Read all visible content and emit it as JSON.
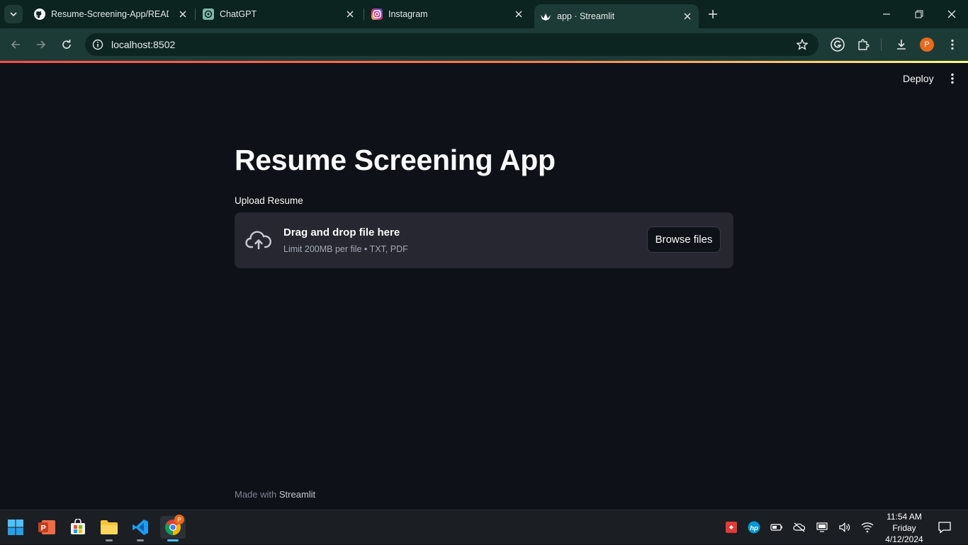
{
  "browser": {
    "tabs": [
      {
        "title": "Resume-Screening-App/READM",
        "icon": "github-icon",
        "active": false
      },
      {
        "title": "ChatGPT",
        "icon": "chatgpt-icon",
        "active": false
      },
      {
        "title": "Instagram",
        "icon": "instagram-icon",
        "active": false
      },
      {
        "title": "app · Streamlit",
        "icon": "streamlit-icon",
        "active": true
      }
    ],
    "url": "localhost:8502",
    "profile_initial": "P"
  },
  "app": {
    "deploy_label": "Deploy",
    "title": "Resume Screening App",
    "uploader": {
      "label": "Upload Resume",
      "drop_text": "Drag and drop file here",
      "limit_text": "Limit 200MB per file • TXT, PDF",
      "browse_label": "Browse files"
    },
    "footer": {
      "prefix": "Made with",
      "brand": "Streamlit"
    }
  },
  "taskbar": {
    "apps": [
      "start-icon",
      "powerpoint-icon",
      "store-icon",
      "file-explorer-icon",
      "vscode-icon",
      "chrome-icon"
    ],
    "clock": {
      "time": "11:54 AM",
      "day": "Friday",
      "date": "4/12/2024"
    }
  },
  "colors": {
    "accent": "#ff4b4b",
    "background": "#0e1117",
    "panel": "#262730"
  }
}
